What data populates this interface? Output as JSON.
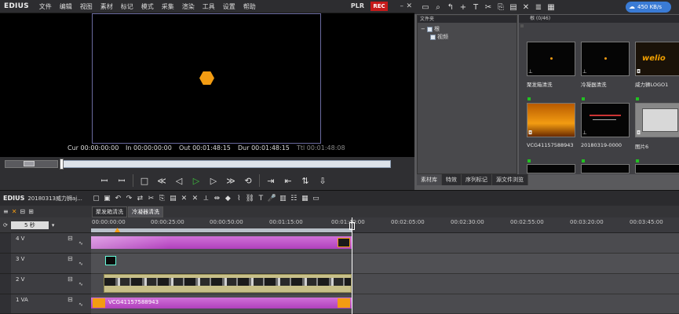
{
  "menubar": {
    "logo": "EDIUS",
    "items": [
      "文件",
      "编辑",
      "视图",
      "素材",
      "标记",
      "模式",
      "采集",
      "渲染",
      "工具",
      "设置",
      "帮助"
    ],
    "plr": "PLR",
    "rec": "REC"
  },
  "timecodes": [
    {
      "label": "Cur",
      "value": "00:00:00:00"
    },
    {
      "label": "In",
      "value": "00:00:00:00"
    },
    {
      "label": "Out",
      "value": "00:01:48:15"
    },
    {
      "label": "Dur",
      "value": "00:01:48:15"
    },
    {
      "label": "Ttl",
      "value": "00:01:48:08"
    }
  ],
  "bin": {
    "network_speed": "450 KB/s",
    "folder_header": "文件夹",
    "tree_root": "根",
    "tree_child": "视频",
    "clip_header": "根 (0/46)",
    "clips": [
      "聚发箱清洗",
      "冷凝器清洗",
      "威力狮LOGO1",
      "VCG41157588943",
      "20180319-0000",
      "图片6"
    ],
    "logo_text": "welio",
    "tabs": [
      "素材库",
      "特效",
      "序列标记",
      "源文件浏览"
    ]
  },
  "timeline": {
    "logo": "EDIUS",
    "project": "20180313威力狮aj...",
    "seq_tabs": [
      "聚发箱清洗",
      "冷凝器清洗"
    ],
    "zoom": "5 秒",
    "ruler_labels": [
      "00:00:00:00",
      "00:00:25:00",
      "00:00:50:00",
      "00:01:15:00",
      "00:01:40:00",
      "00:02:05:00",
      "00:02:30:00",
      "00:02:55:00",
      "00:03:20:00",
      "00:03:45:00"
    ],
    "tracks": [
      "4 V",
      "3 V",
      "2 V",
      "1 VA"
    ],
    "clip_label": "VCG41157588943"
  },
  "colors": {
    "accent_orange": "#f39c12",
    "rec_red": "#c61a1a",
    "play_green": "#3ec43e",
    "clip_magenta": "#c040c8",
    "clip_olive": "#c8c088"
  }
}
